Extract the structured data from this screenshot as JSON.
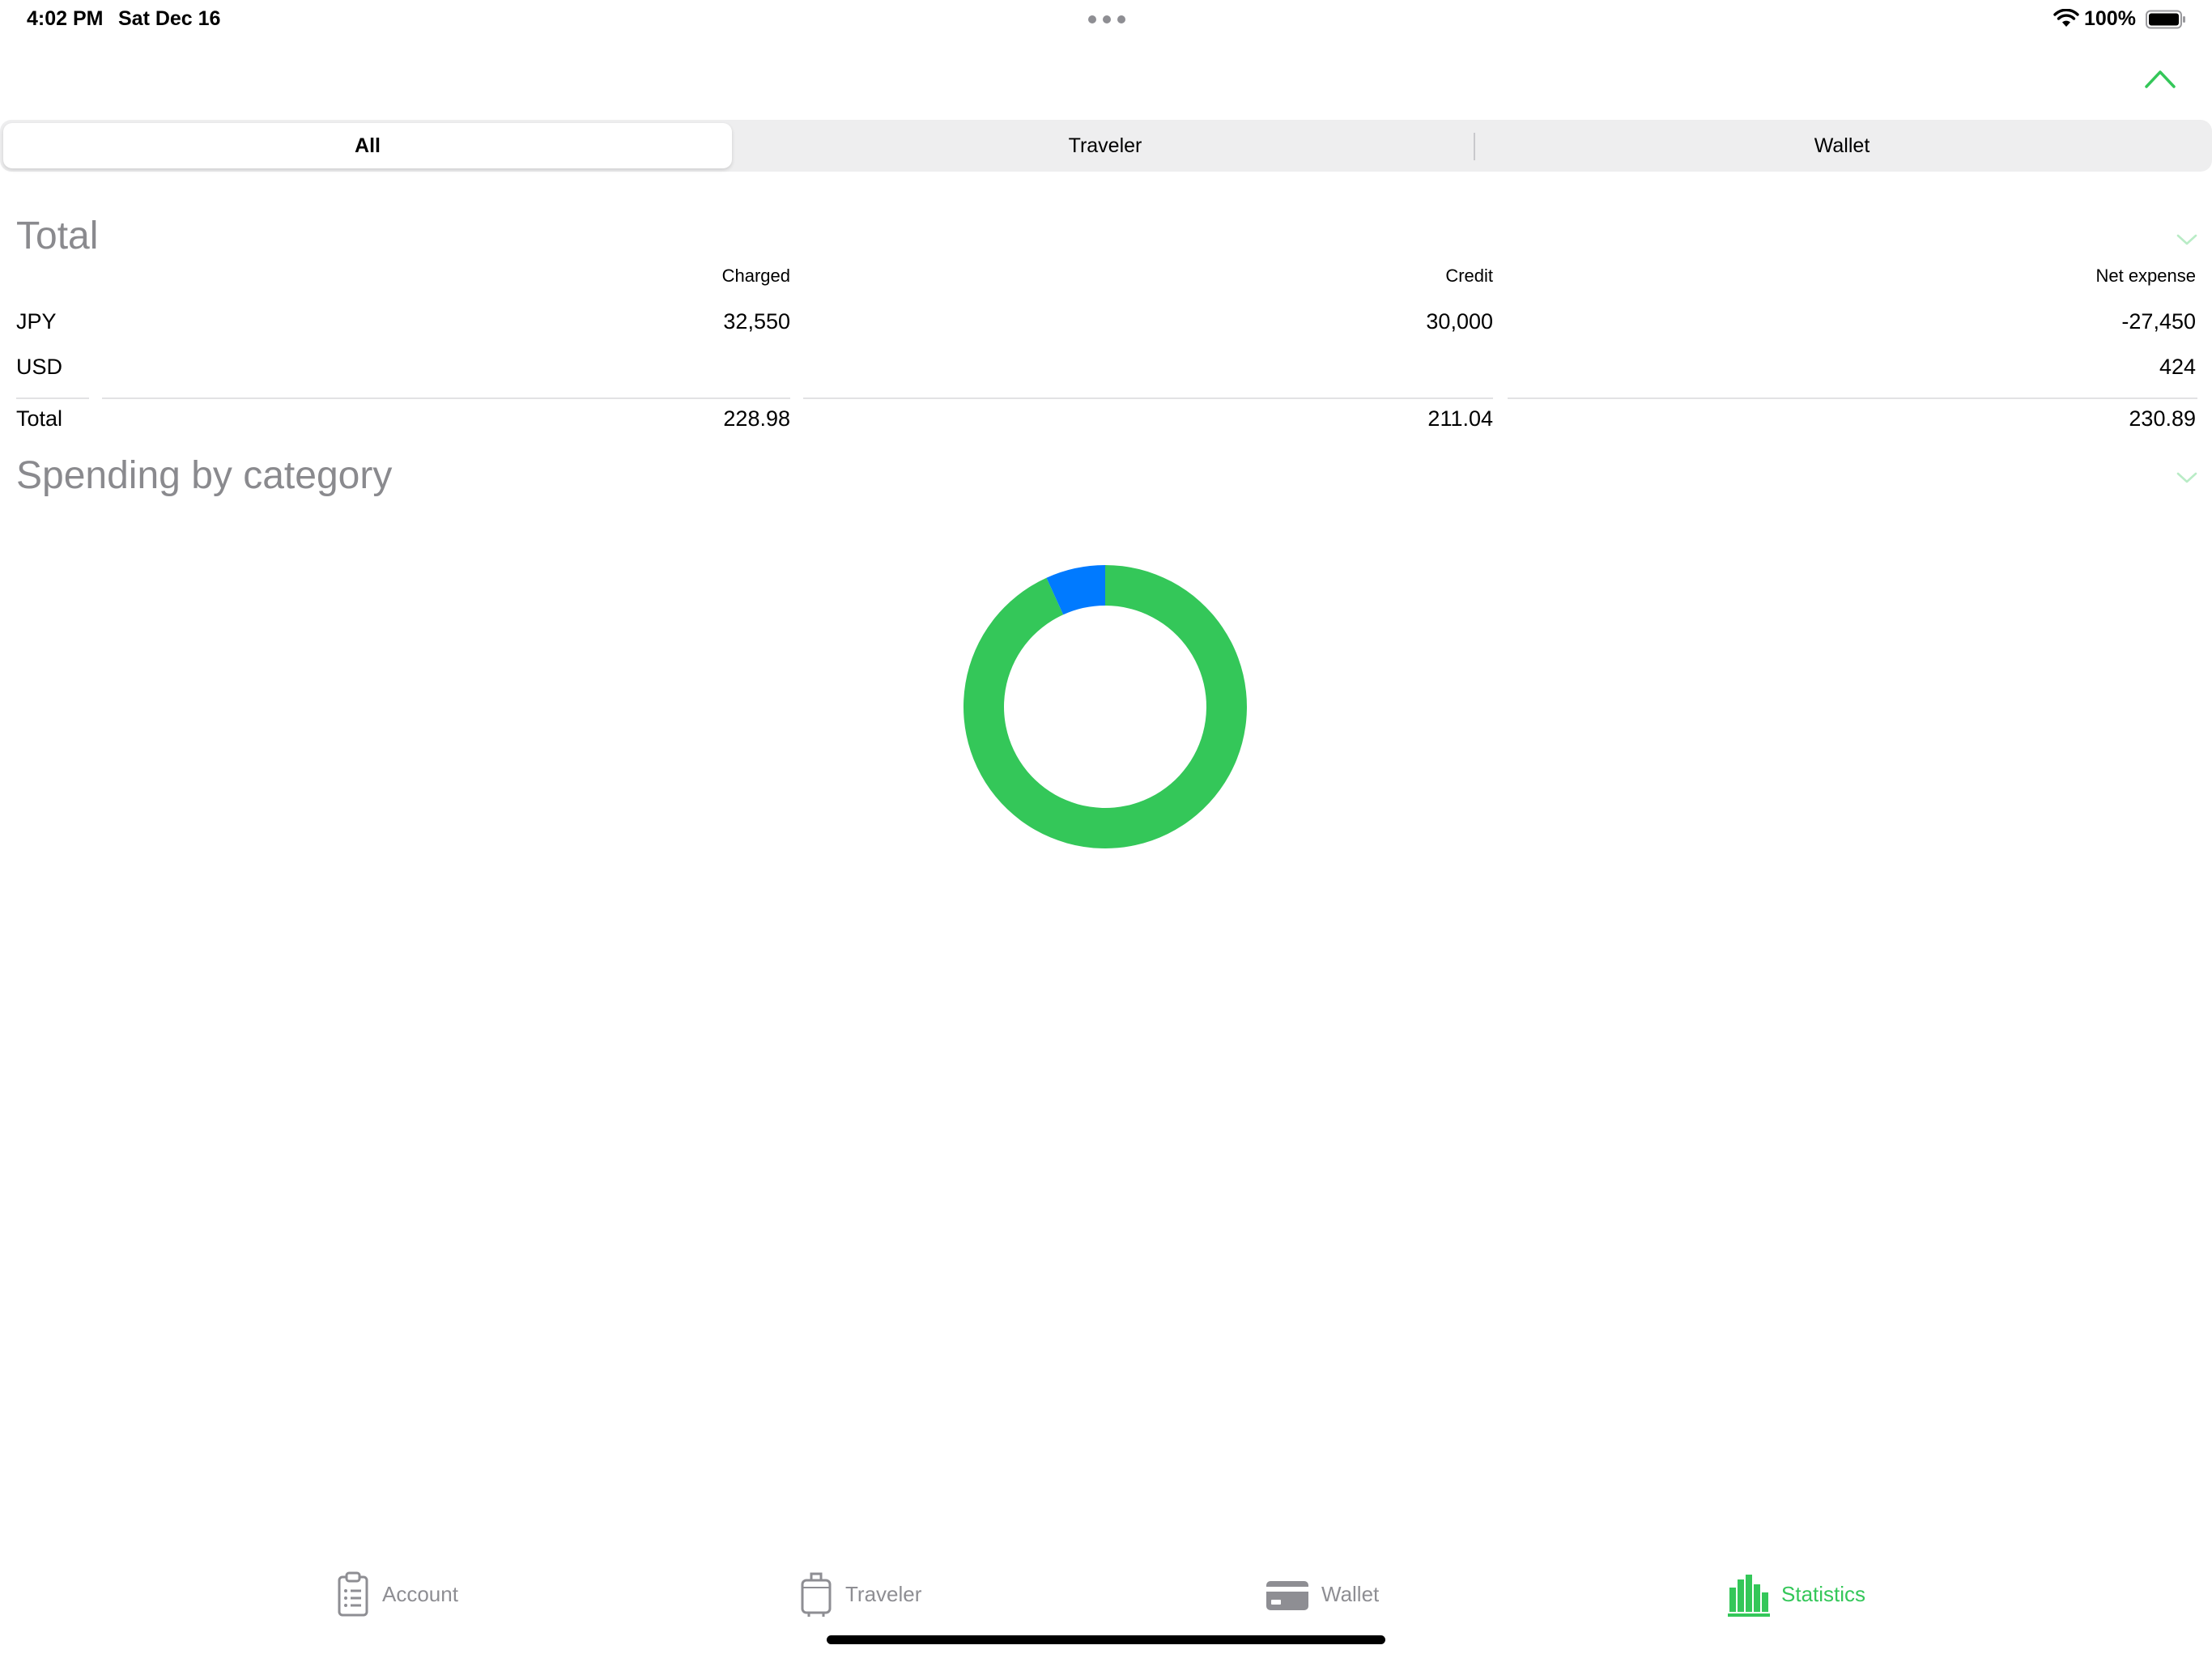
{
  "status_bar": {
    "time": "4:02 PM",
    "date": "Sat Dec 16",
    "battery": "100%"
  },
  "segmented": {
    "options": [
      "All",
      "Traveler",
      "Wallet"
    ],
    "selected": "All"
  },
  "total": {
    "title": "Total",
    "columns": [
      "Charged",
      "Credit",
      "Net expense"
    ],
    "rows": [
      {
        "label": "JPY",
        "charged": "32,550",
        "credit": "30,000",
        "net": "-27,450"
      },
      {
        "label": "USD",
        "charged": "",
        "credit": "",
        "net": "424"
      }
    ],
    "summary": {
      "label": "Total",
      "charged": "228.98",
      "credit": "211.04",
      "net": "230.89"
    }
  },
  "spending": {
    "title": "Spending by category"
  },
  "chart_data": {
    "type": "pie",
    "style": "donut",
    "slices": [
      {
        "share": 0.932,
        "color": "#34c759"
      },
      {
        "share": 0.068,
        "color": "#007aff"
      }
    ]
  },
  "tab_bar": {
    "items": [
      {
        "label": "Account",
        "icon": "clipboard-icon"
      },
      {
        "label": "Traveler",
        "icon": "suitcase-icon"
      },
      {
        "label": "Wallet",
        "icon": "card-icon"
      },
      {
        "label": "Statistics",
        "icon": "bar-chart-icon"
      }
    ],
    "active": "Statistics"
  },
  "colors": {
    "accent": "#34c759",
    "blue": "#007aff",
    "inactive": "#8e8e93"
  }
}
